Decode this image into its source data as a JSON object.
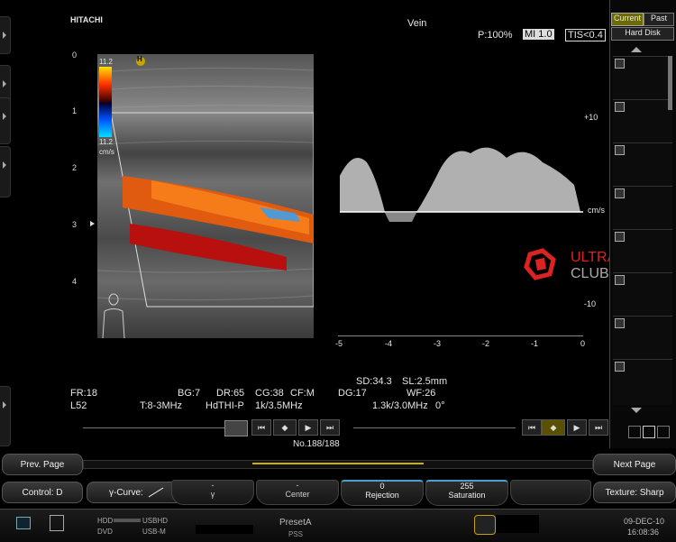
{
  "header": {
    "brand": "HITACHI",
    "preset_name": "Vein",
    "power": "P:100%",
    "mi": "MI 1.0",
    "tis": "TIS<0.4"
  },
  "image": {
    "depth_marks": [
      "0",
      "1",
      "2",
      "3",
      "4"
    ],
    "color_scale_top": "11.2",
    "color_scale_bottom": "11.2",
    "color_scale_unit": "cm/s",
    "focus_marker": "H"
  },
  "doppler": {
    "scale_labels": [
      "+10",
      "-10"
    ],
    "unit": "cm/s",
    "time_ticks": [
      "-5",
      "-4",
      "-3",
      "-2",
      "-1",
      "0"
    ]
  },
  "watermark": {
    "line1": "ULTRASOUND",
    "line2": "CLUB"
  },
  "params": {
    "fr": "FR:18",
    "probe": "L52",
    "bg": "BG:7",
    "freq": "T:8-3MHz",
    "dr": "DR:65",
    "hdthi": "HdTHI-P",
    "cg": "CG:38",
    "cfm": "CF:M",
    "cf_prf": "1k/3.5MHz",
    "sd": "SD:34.3",
    "sl": "SL:2.5mm",
    "dg": "DG:17",
    "dop_prf": "1.3k/3.0MHz",
    "wf": "WF:26",
    "angle": "0°"
  },
  "cine": {
    "frame": "No.188/188"
  },
  "thumbs": {
    "tab_current": "Current",
    "tab_past": "Past",
    "hard_disk": "Hard Disk"
  },
  "buttons": {
    "prev_page": "Prev. Page",
    "next_page": "Next Page",
    "control": "Control: D",
    "gamma_curve": "γ-Curve:",
    "gamma_value": "-",
    "gamma_label": "γ",
    "center_value": "-",
    "center_label": "Center",
    "rejection_value": "0",
    "rejection_label": "Rejection",
    "saturation_value": "255",
    "saturation_label": "Saturation",
    "texture": "Texture: Sharp"
  },
  "status": {
    "hdd": "HDD",
    "usbhd": "USBHD",
    "dvd": "DVD",
    "usbm": "USB-M",
    "preset": "PresetA",
    "pss": "PSS",
    "date": "09-DEC-10",
    "time": "16:08:36"
  }
}
